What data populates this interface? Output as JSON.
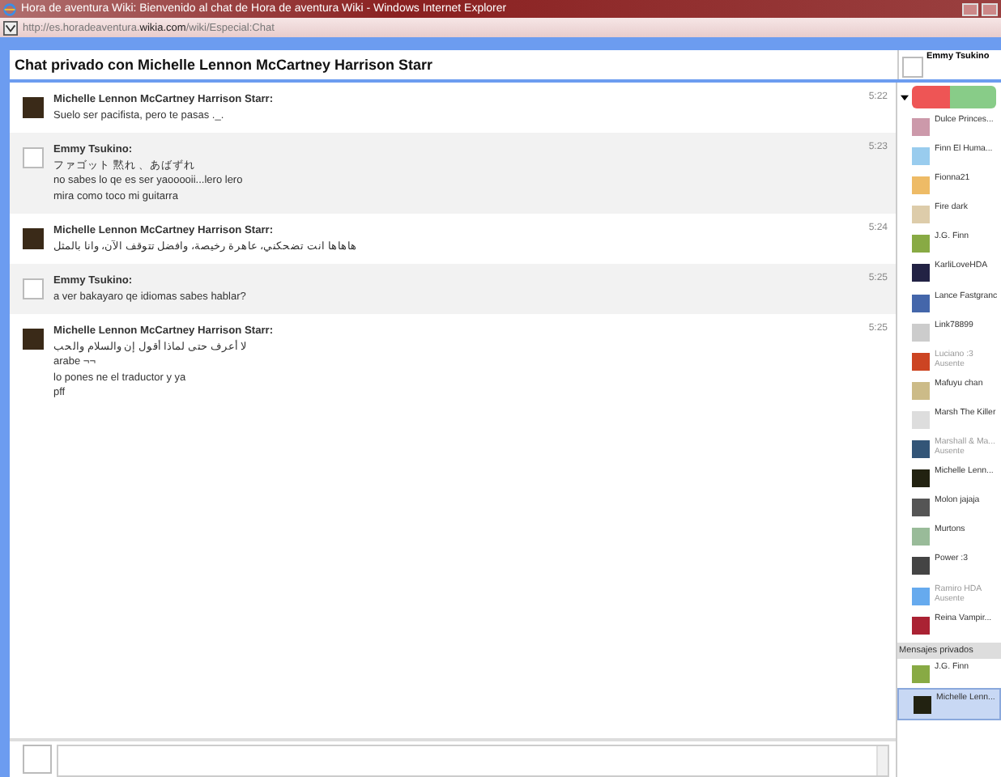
{
  "window": {
    "title": "Hora de aventura Wiki: Bienvenido al chat de Hora de aventura Wiki - Windows Internet Explorer"
  },
  "address_bar": {
    "url_prefix": "http://es.horadeaventura.",
    "url_domain": "wikia.com",
    "url_path": "/wiki/Especial:Chat"
  },
  "chat": {
    "title": "Chat privado con Michelle Lennon McCartney Harrison Starr",
    "messages": [
      {
        "author": "Michelle Lennon McCartney Harrison Starr:",
        "time": "5:22",
        "lines": [
          "Suelo ser pacifista, pero te pasas ._."
        ]
      },
      {
        "author": "Emmy Tsukino:",
        "time": "5:23",
        "lines": [
          "ファゴット 黙れ 、あばずれ",
          "no sabes lo qe es ser yaooooii...lero lero",
          "mira como toco mi guitarra"
        ]
      },
      {
        "author": "Michelle Lennon McCartney Harrison Starr:",
        "time": "5:24",
        "lines": [
          "هاهاها انت تضحكني، عاهرة رخيصة، وافضل تتوقف الآن، وانا بالمثل"
        ]
      },
      {
        "author": "Emmy Tsukino:",
        "time": "5:25",
        "lines": [
          "a ver bakayaro qe idiomas sabes hablar?"
        ]
      },
      {
        "author": "Michelle Lennon McCartney Harrison Starr:",
        "time": "5:25",
        "lines": [
          "لا أعرف حتى لماذا أقول إن والسلام والحب",
          "arabe ¬¬",
          "lo pones ne el traductor y ya",
          "pff"
        ]
      }
    ]
  },
  "sidebar": {
    "current_user": "Emmy Tsukino",
    "users": [
      {
        "name": "Dulce Princes...",
        "away": false
      },
      {
        "name": "Finn El Huma...",
        "away": false
      },
      {
        "name": "Fionna21",
        "away": false
      },
      {
        "name": "Fire dark",
        "away": false
      },
      {
        "name": "J.G. Finn",
        "away": false
      },
      {
        "name": "KarliLoveHDA",
        "away": false
      },
      {
        "name": "Lance Fastgranc",
        "away": false
      },
      {
        "name": "Link78899",
        "away": false
      },
      {
        "name": "Luciano :3",
        "away": true,
        "status": "Ausente"
      },
      {
        "name": "Mafuyu chan",
        "away": false
      },
      {
        "name": "Marsh The Killer",
        "away": false
      },
      {
        "name": "Marshall & Ma...",
        "away": true,
        "status": "Ausente"
      },
      {
        "name": "Michelle Lenn...",
        "away": false
      },
      {
        "name": "Molon jajaja",
        "away": false
      },
      {
        "name": "Murtons",
        "away": false
      },
      {
        "name": "Power :3",
        "away": false
      },
      {
        "name": "Ramiro HDA",
        "away": true,
        "status": "Ausente"
      },
      {
        "name": "Reina Vampir...",
        "away": false
      }
    ],
    "private_header": "Mensajes privados",
    "private": [
      {
        "name": "J.G. Finn",
        "selected": false
      },
      {
        "name": "Michelle Lenn...",
        "selected": true
      }
    ]
  }
}
